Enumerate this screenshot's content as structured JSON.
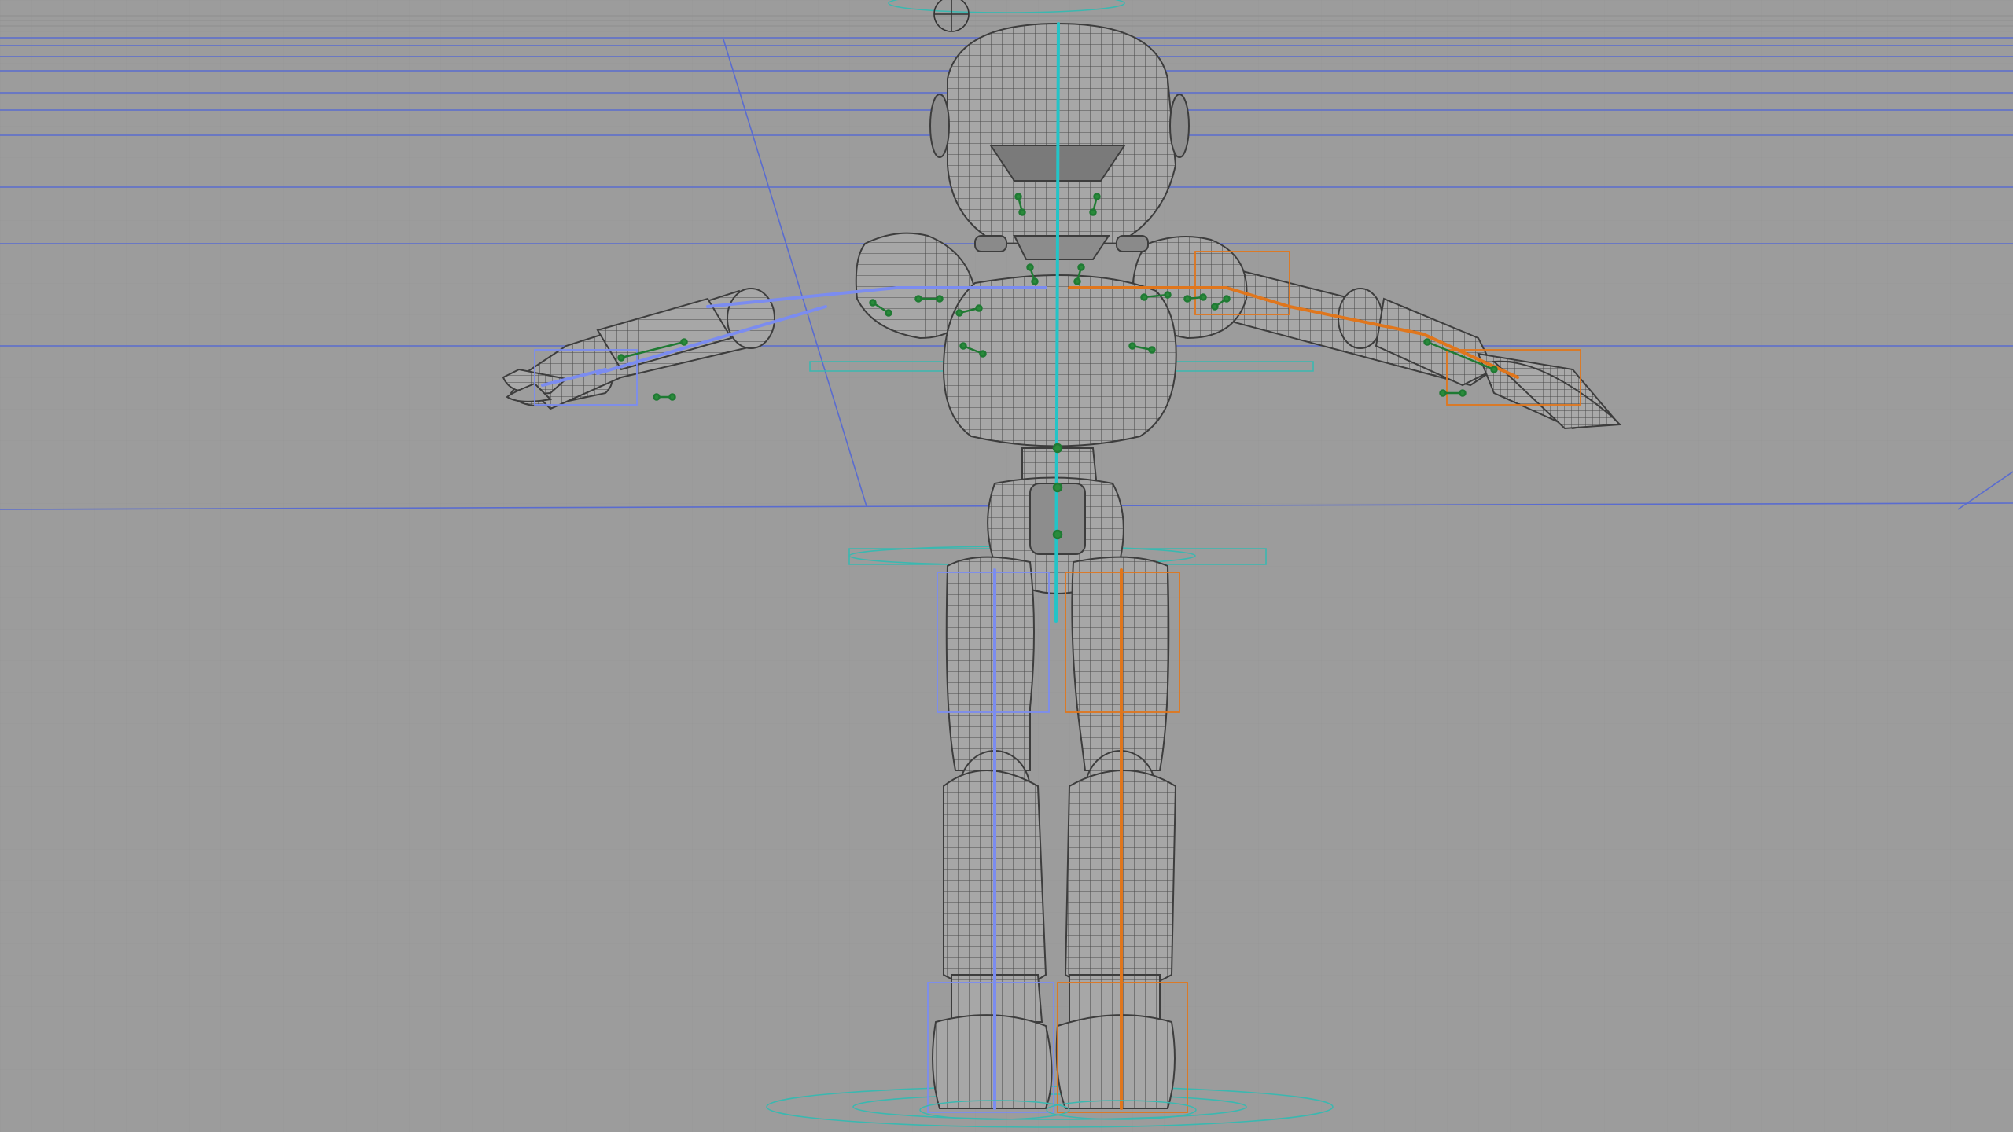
{
  "viewport": {
    "background_color": "#9c9c9c",
    "grid_color": "#8a8a8a",
    "floor_line_color": "#5a6ccf",
    "mesh_color": "#4a4a4a",
    "mesh_fill": "#a6a6a6",
    "left_bone_color": "#7b8cf0",
    "right_bone_color": "#e0761c",
    "spine_bone_color": "#23c4c7",
    "control_color": "#1f7a33",
    "ground_ring_color": "#3ab8b0"
  },
  "scene": {
    "object": "robot-character",
    "pose": "t-pose",
    "display_mode": "wireframe-on-shaded",
    "rig_visible": true
  },
  "icons": {
    "top_gizmo": "crosshair-circle-icon"
  }
}
